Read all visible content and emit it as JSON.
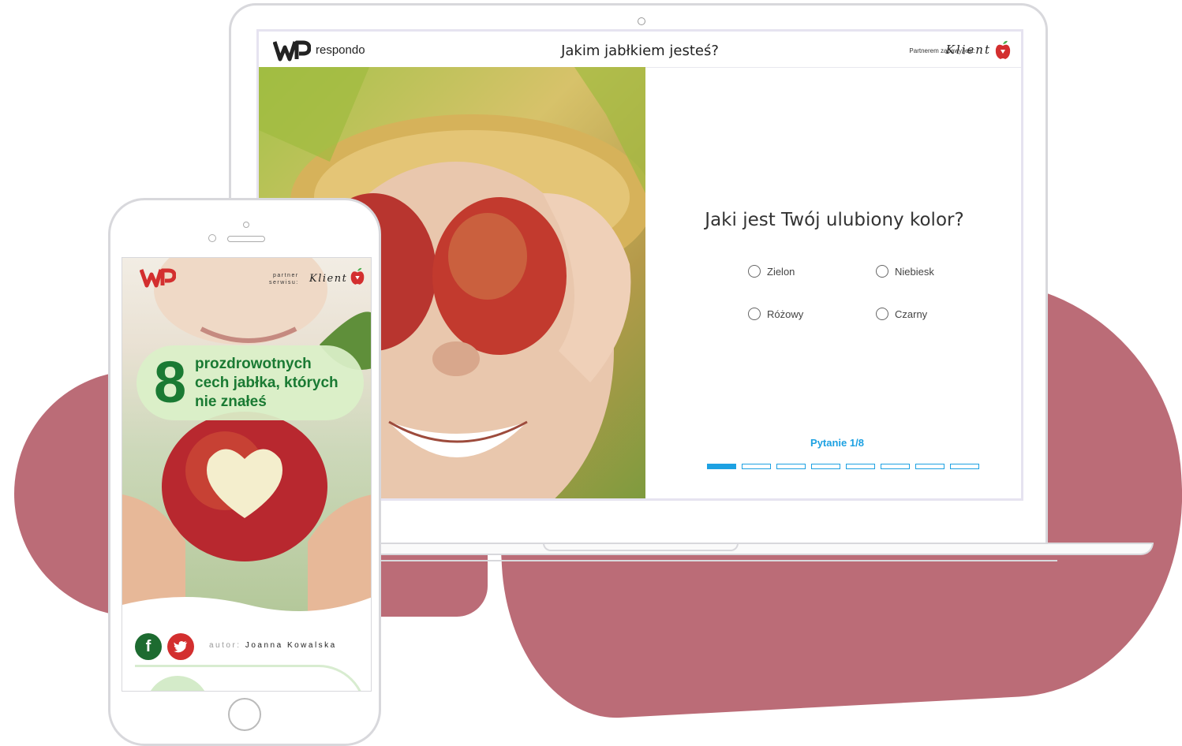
{
  "laptop": {
    "brand": "respondo",
    "title": "Jakim jabłkiem jesteś?",
    "partner_label": "Partnerem zabawy jest:",
    "client": "Klient",
    "question": "Jaki jest Twój ulubiony kolor?",
    "options": [
      "Zielon",
      "Niebiesk",
      "Różowy",
      "Czarny"
    ],
    "progress_label": "Pytanie 1/8",
    "progress": {
      "current": 1,
      "total": 8
    }
  },
  "phone": {
    "partner_line1": "partner",
    "partner_line2": "serwisu:",
    "client": "Klient",
    "badge_number": "8",
    "badge_line1": "prozdrowotnych",
    "badge_line2": "cech jabłka, których",
    "badge_line3": "nie znałeś",
    "author_label": "autor:",
    "author_name": "Joanna Kowalska",
    "facebook": "f",
    "twitter": "t"
  },
  "colors": {
    "blob": "#bb6c77",
    "accent_blue": "#1da1e2",
    "green": "#1a7a33",
    "red": "#d32f2f"
  }
}
